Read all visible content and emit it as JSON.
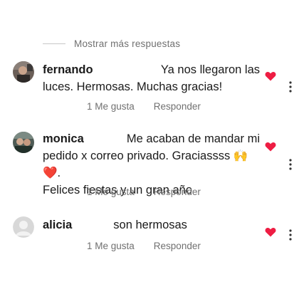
{
  "more_replies": {
    "label": "Mostrar más respuestas"
  },
  "comments": [
    {
      "username": "fernando",
      "text_lead": "Ya nos llegaron las",
      "text_rest": "luces. Hermosas. Muchas gracias!",
      "likes": "1 Me gusta",
      "reply": "Responder",
      "liked": true
    },
    {
      "username": "monica",
      "text_lead": "Me acaban de mandar mi",
      "text_rest": "pedido x correo privado. Graciassss 🙌❤️.",
      "text_rest2": "Felices fiestas y un gran año",
      "likes": "1 Me gusta",
      "reply": "Responder",
      "liked": true
    },
    {
      "username": "alicia",
      "text_lead": "son hermosas",
      "likes": "1 Me gusta",
      "reply": "Responder",
      "liked": true
    }
  ],
  "colors": {
    "heart": "#ee1d43",
    "muted_text": "#707070",
    "divider": "#c7c7c7"
  },
  "icons": [
    "heart-icon",
    "more-options-icon",
    "default-avatar-icon"
  ]
}
